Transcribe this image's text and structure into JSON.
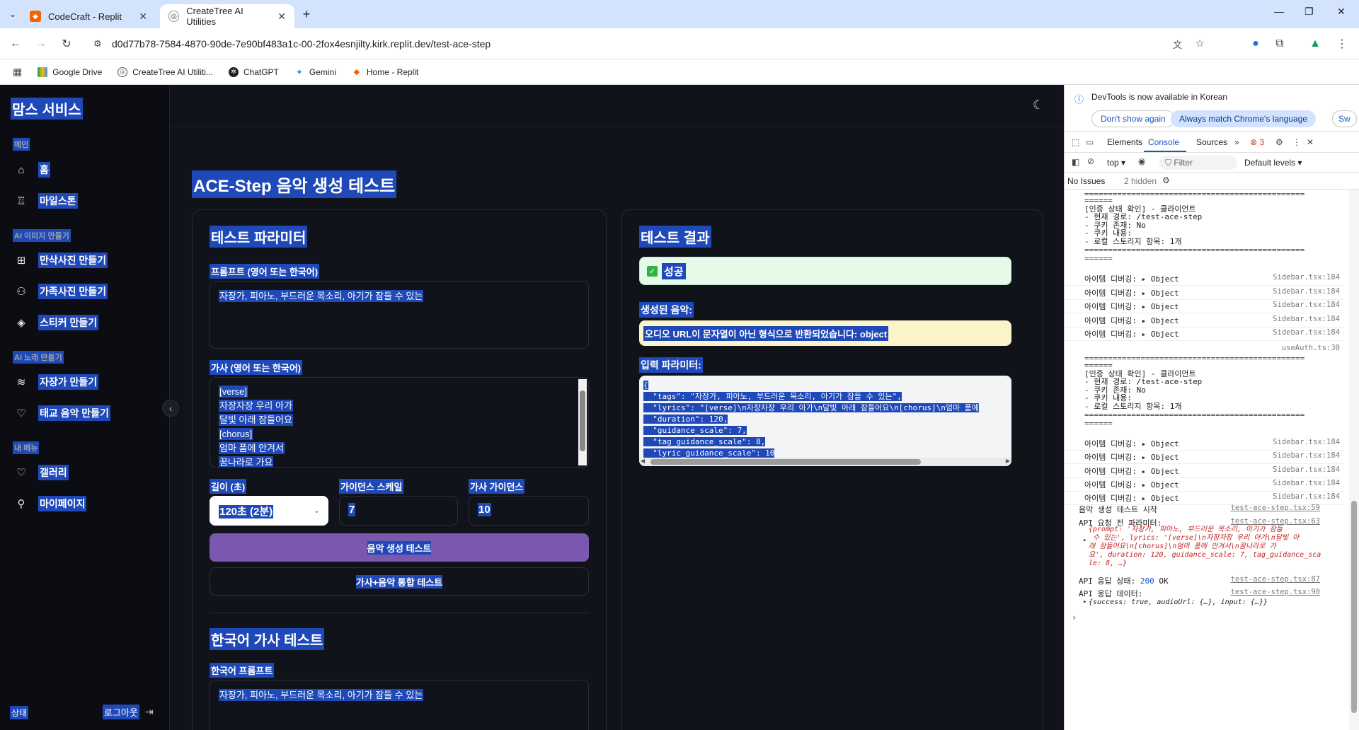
{
  "browser": {
    "tabs": [
      {
        "title": "CodeCraft - Replit",
        "active": false
      },
      {
        "title": "CreateTree AI Utilities",
        "active": true
      }
    ],
    "url": "d0d77b78-7584-4870-90de-7e90bf483a1c-00-2fox4esnjilty.kirk.replit.dev/test-ace-step",
    "bookmarks": [
      "Google Drive",
      "CreateTree AI Utiliti...",
      "ChatGPT",
      "Gemini",
      "Home - Replit"
    ]
  },
  "sidebar": {
    "brand": "맘스 서비스",
    "sections": [
      {
        "label": "메인",
        "items": [
          {
            "label": "홈",
            "icon": "home-icon"
          },
          {
            "label": "마일스톤",
            "icon": "award-icon"
          }
        ]
      },
      {
        "label": "AI 이미지 만들기",
        "items": [
          {
            "label": "만삭사진 만들기",
            "icon": "image-plus-icon"
          },
          {
            "label": "가족사진 만들기",
            "icon": "users-icon"
          },
          {
            "label": "스티커 만들기",
            "icon": "sticker-icon"
          }
        ]
      },
      {
        "label": "AI 노래 만들기",
        "items": [
          {
            "label": "자장가 만들기",
            "icon": "layers-icon"
          },
          {
            "label": "태교 음악 만들기",
            "icon": "heart-icon"
          }
        ]
      },
      {
        "label": "내 메뉴",
        "items": [
          {
            "label": "갤러리",
            "icon": "heart-icon"
          },
          {
            "label": "마이페이지",
            "icon": "user-icon"
          }
        ]
      }
    ],
    "footer": {
      "status": "상태",
      "logout": "로그아웃"
    }
  },
  "main": {
    "title": "ACE-Step 음악 생성 테스트",
    "params": {
      "title": "테스트 파라미터",
      "prompt_label": "프롬프트 (영어 또는 한국어)",
      "prompt_value": "자장가, 피아노, 부드러운 목소리, 아기가 잠들 수 있는",
      "lyrics_label": "가사 (영어 또는 한국어)",
      "lyrics_lines": [
        "[verse]",
        "자장자장 우리 아가",
        "달빛 아래 잠들어요",
        "[chorus]",
        "엄마 품에 안겨서",
        "꿈나라로 가요"
      ],
      "duration_label": "길이 (초)",
      "duration_value": "120초 (2분)",
      "guidance_label": "가이던스 스케일",
      "guidance_value": "7",
      "lyric_guidance_label": "가사 가이던스",
      "lyric_guidance_value": "10",
      "generate_button": "음악 생성 테스트",
      "combined_button": "가사+음악 통합 테스트"
    },
    "korean": {
      "title": "한국어 가사 테스트",
      "prompt_label": "한국어 프롬프트",
      "prompt_value": "자장가, 피아노, 부드러운 목소리, 아기가 잠들 수 있는"
    },
    "result": {
      "title": "테스트 결과",
      "status": "성공",
      "status_icon": "check-box-icon",
      "music_label": "생성된 음악:",
      "music_warning": "오디오 URL이 문자열이 아닌 형식으로 반환되었습니다: object",
      "params_label": "입력 파라미터:",
      "params_json": "{\n  \"tags\": \"자장가, 피아노, 부드러운 목소리, 아기가 잠들 수 있는\",\n  \"lyrics\": \"[verse]\\n자장자장 우리 아가\\n달빛 아래 잠들어요\\n[chorus]\\n엄마 품에\n  \"duration\": 120,\n  \"guidance_scale\": 7,\n  \"tag_guidance_scale\": 8,\n  \"lyric_guidance_scale\": 10\n}"
    }
  },
  "devtools": {
    "info": "DevTools is now available in Korean",
    "btn_dont_show": "Don't show again",
    "btn_match": "Always match Chrome's language",
    "btn_sw": "Sw",
    "tabs": [
      "Elements",
      "Console",
      "Sources"
    ],
    "error_count": "3",
    "context": "top",
    "filter_placeholder": "Filter",
    "levels": "Default levels",
    "issues": "No Issues",
    "hidden": "2 hidden",
    "log1": "======\n[인증 상태 확인] - 클라이언트\n- 현재 경로: /test-ace-step\n- 쿠키 존재: No\n- 쿠키 내용:\n- 로컬 스토리지 항목: 1개",
    "sep": "===============================================",
    "sep_end": "======",
    "item_debug": "아이템 디버깅:",
    "object": "Object",
    "src_sidebar": "Sidebar.tsx:184",
    "src_auth": "useAuth.ts:30",
    "start": "음악 생성 테스트 시작",
    "src_59": "test-ace-step.tsx:59",
    "req_label": "API 요청 전 파라미터:",
    "src_63": "test-ace-step.tsx:63",
    "req_obj": "{prompt: '자장가, 피아노, 부드러운 목소리, 아기가 잠들\n 수 있는', lyrics: '[verse]\\n자장자장 우리 아가\\n달빛 아\n래 잠들어요\\n[chorus]\\n엄마 품에 안겨서\\n꿈나라로 가\n요', duration: 120, guidance_scale: 7, tag_guidance_sca\nle: 8, …}",
    "res_status_label": "API 응답 상태:",
    "res_status_code": "200",
    "res_status_text": "OK",
    "src_87": "test-ace-step.tsx:87",
    "res_data_label": "API 응답 데이터:",
    "src_90": "test-ace-step.tsx:90",
    "res_obj": "{success: true, audioUrl: {…}, input: {…}}"
  }
}
